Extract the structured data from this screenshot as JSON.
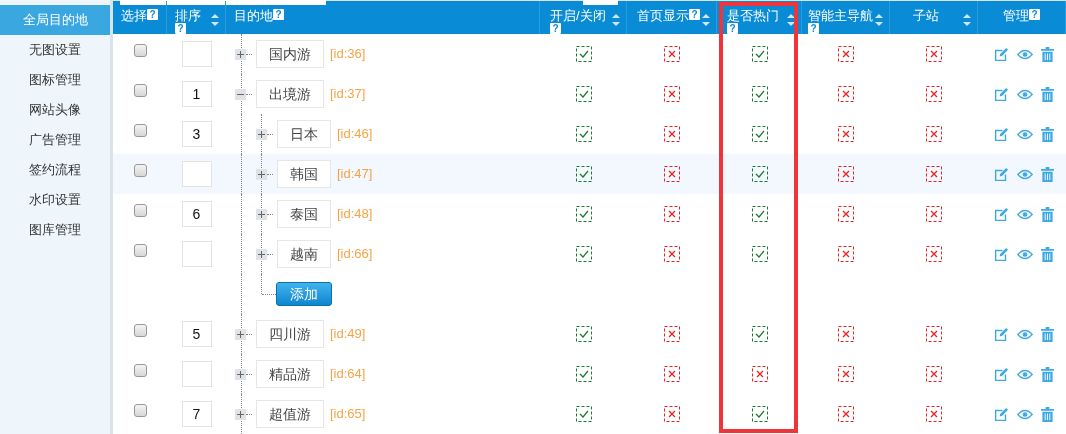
{
  "sidebar": {
    "items": [
      {
        "label": "全局目的地",
        "selected": true
      },
      {
        "label": "无图设置",
        "selected": false
      },
      {
        "label": "图标管理",
        "selected": false
      },
      {
        "label": "网站头像",
        "selected": false
      },
      {
        "label": "广告管理",
        "selected": false
      },
      {
        "label": "签约流程",
        "selected": false
      },
      {
        "label": "水印设置",
        "selected": false
      },
      {
        "label": "图库管理",
        "selected": false
      }
    ]
  },
  "table": {
    "columns": [
      {
        "label": "选择",
        "help": "?",
        "sortable": false
      },
      {
        "label": "排序",
        "help": "?",
        "sortable": true
      },
      {
        "label": "目的地",
        "help": "?",
        "sortable": false
      },
      {
        "label": "开启/关闭",
        "help": "?",
        "sortable": true
      },
      {
        "label": "首页显示",
        "help": "?",
        "sortable": true
      },
      {
        "label": "是否热门",
        "help": "?",
        "sortable": true
      },
      {
        "label": "智能主导航",
        "help": "?",
        "sortable": true
      },
      {
        "label": "子站",
        "sortable": true
      },
      {
        "label": "管理",
        "help": "?",
        "sortable": false
      }
    ],
    "rows": [
      {
        "checked": false,
        "name": "国内游",
        "id": "[id:36]",
        "expanded": false,
        "highlighted": false,
        "flags": {
          "open": true,
          "home": false,
          "hot": true,
          "nav": false,
          "sub": false
        }
      },
      {
        "checked": false,
        "order": "1",
        "name": "出境游",
        "id": "[id:37]",
        "expanded": true,
        "highlighted": false,
        "flags": {
          "open": true,
          "home": false,
          "hot": true,
          "nav": false,
          "sub": false
        },
        "add_button": "添加",
        "children": [
          {
            "checked": false,
            "order": "3",
            "name": "日本",
            "id": "[id:46]",
            "expanded": false,
            "highlighted": false,
            "flags": {
              "open": true,
              "home": false,
              "hot": true,
              "nav": false,
              "sub": false
            }
          },
          {
            "checked": false,
            "name": "韩国",
            "id": "[id:47]",
            "expanded": false,
            "highlighted": true,
            "flags": {
              "open": true,
              "home": false,
              "hot": true,
              "nav": false,
              "sub": false
            }
          },
          {
            "checked": false,
            "order": "6",
            "name": "泰国",
            "id": "[id:48]",
            "expanded": false,
            "highlighted": false,
            "flags": {
              "open": true,
              "home": false,
              "hot": true,
              "nav": false,
              "sub": false
            }
          },
          {
            "checked": false,
            "name": "越南",
            "id": "[id:66]",
            "expanded": false,
            "highlighted": false,
            "flags": {
              "open": true,
              "home": false,
              "hot": true,
              "nav": false,
              "sub": false
            }
          }
        ]
      },
      {
        "checked": false,
        "order": "5",
        "name": "四川游",
        "id": "[id:49]",
        "expanded": false,
        "highlighted": false,
        "flags": {
          "open": true,
          "home": false,
          "hot": true,
          "nav": false,
          "sub": false
        }
      },
      {
        "checked": false,
        "name": "精品游",
        "id": "[id:64]",
        "expanded": false,
        "highlighted": false,
        "flags": {
          "open": true,
          "home": false,
          "hot": false,
          "nav": false,
          "sub": false
        }
      },
      {
        "checked": false,
        "order": "7",
        "name": "超值游",
        "id": "[id:65]",
        "expanded": false,
        "highlighted": false,
        "flags": {
          "open": true,
          "home": false,
          "hot": true,
          "nav": false,
          "sub": false
        }
      }
    ]
  }
}
